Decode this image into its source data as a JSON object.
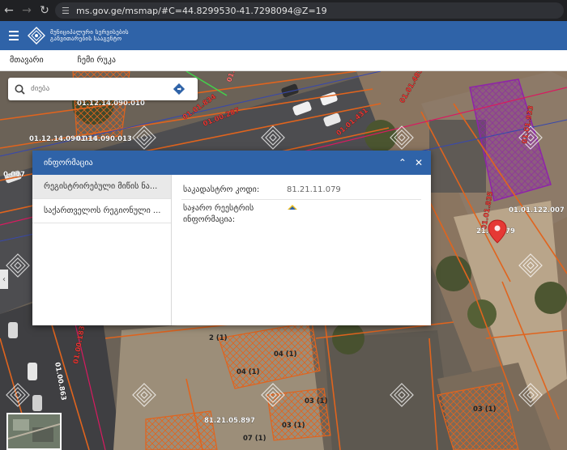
{
  "browser": {
    "url": "ms.gov.ge/msmap/#C=44.8299530-41.7298094@Z=19"
  },
  "app": {
    "brand_line1": "მუნიციპალური სერვისების",
    "brand_line2": "განვითარების სააგენტო"
  },
  "menu": {
    "items": [
      {
        "label": "მთავარი"
      },
      {
        "label": "ჩემი რუკა"
      }
    ]
  },
  "search": {
    "placeholder": "ძიება"
  },
  "map": {
    "labels": [
      "01.12.14.090.010",
      "01.12.14.090.014",
      "01.14.090.013",
      "01.00.183",
      "01.00.287",
      "01.01.834",
      "01.01.431",
      "01.01.485",
      "01.01.933",
      "01.01.122.007",
      "01.01.835",
      "21.11.079",
      "0.017",
      "01.00.183",
      "01.00.863",
      "81.21.05.897",
      "2 (1)",
      "04 (1)",
      "04 (1)",
      "03 (1)",
      "03 (1)",
      "03 (1)",
      "07 (1)"
    ]
  },
  "dialog": {
    "title": "ინფორმაცია",
    "tabs": [
      {
        "label": "რეგისტრირებული მიწის ნა..."
      },
      {
        "label": "საქართველოს რეგიონული ..."
      }
    ],
    "fields": [
      {
        "key": "საკადასტრო კოდი:",
        "value": "81.21.11.079"
      },
      {
        "key": "საჯარო რეესტრის ინფორმაცია:",
        "value": ""
      }
    ]
  },
  "colors": {
    "brand_blue": "#2f63a8",
    "parcel_orange": "#e0641e",
    "marker_red": "#e53935",
    "highlight_purple": "#8e24aa"
  }
}
